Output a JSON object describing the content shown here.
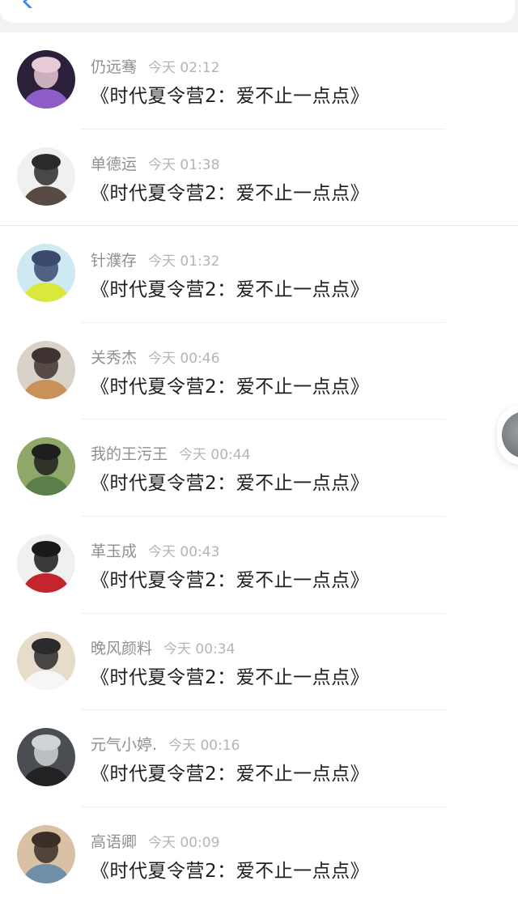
{
  "header": {
    "back_icon": "chevron-left-icon",
    "accent": "#3d8df5"
  },
  "messages": [
    {
      "name": "仍远骞",
      "time": "今天 02:12",
      "text": "《时代夏令营2：爱不止一点点》",
      "avatar": {
        "bg": "#2b1f3a",
        "fg": "#e8c9d6",
        "accent": "#8c5cc8"
      }
    },
    {
      "name": "单德运",
      "time": "今天 01:38",
      "text": "《时代夏令营2：爱不止一点点》",
      "avatar": {
        "bg": "#f0f0f0",
        "fg": "#2a2a2a",
        "accent": "#5a4a44"
      }
    },
    {
      "name": "针濮存",
      "time": "今天 01:32",
      "text": "《时代夏令营2：爱不止一点点》",
      "avatar": {
        "bg": "#cfe9f2",
        "fg": "#3a4a6e",
        "accent": "#d9e83a"
      }
    },
    {
      "name": "关秀杰",
      "time": "今天 00:46",
      "text": "《时代夏令营2：爱不止一点点》",
      "avatar": {
        "bg": "#d9d2c8",
        "fg": "#3e3330",
        "accent": "#c9905a"
      }
    },
    {
      "name": "我的王污王",
      "time": "今天 00:44",
      "text": "《时代夏令营2：爱不止一点点》",
      "avatar": {
        "bg": "#8fa86a",
        "fg": "#1e1e1e",
        "accent": "#5a7f4a"
      }
    },
    {
      "name": "革玉成",
      "time": "今天 00:43",
      "text": "《时代夏令营2：爱不止一点点》",
      "avatar": {
        "bg": "#f0f0f0",
        "fg": "#1a1a1a",
        "accent": "#c4242e"
      }
    },
    {
      "name": "晚风颜料",
      "time": "今天 00:34",
      "text": "《时代夏令营2：爱不止一点点》",
      "avatar": {
        "bg": "#e7dcc9",
        "fg": "#2b2b2b",
        "accent": "#f6f6f6"
      }
    },
    {
      "name": "元气小婷.",
      "time": "今天 00:16",
      "text": "《时代夏令营2：爱不止一点点》",
      "avatar": {
        "bg": "#4a4e52",
        "fg": "#cfd3d6",
        "accent": "#222222"
      }
    },
    {
      "name": "高语卿",
      "time": "今天 00:09",
      "text": "《时代夏令营2：爱不止一点点》",
      "avatar": {
        "bg": "#d8c1a4",
        "fg": "#3a2e26",
        "accent": "#6f8fa8"
      }
    }
  ]
}
